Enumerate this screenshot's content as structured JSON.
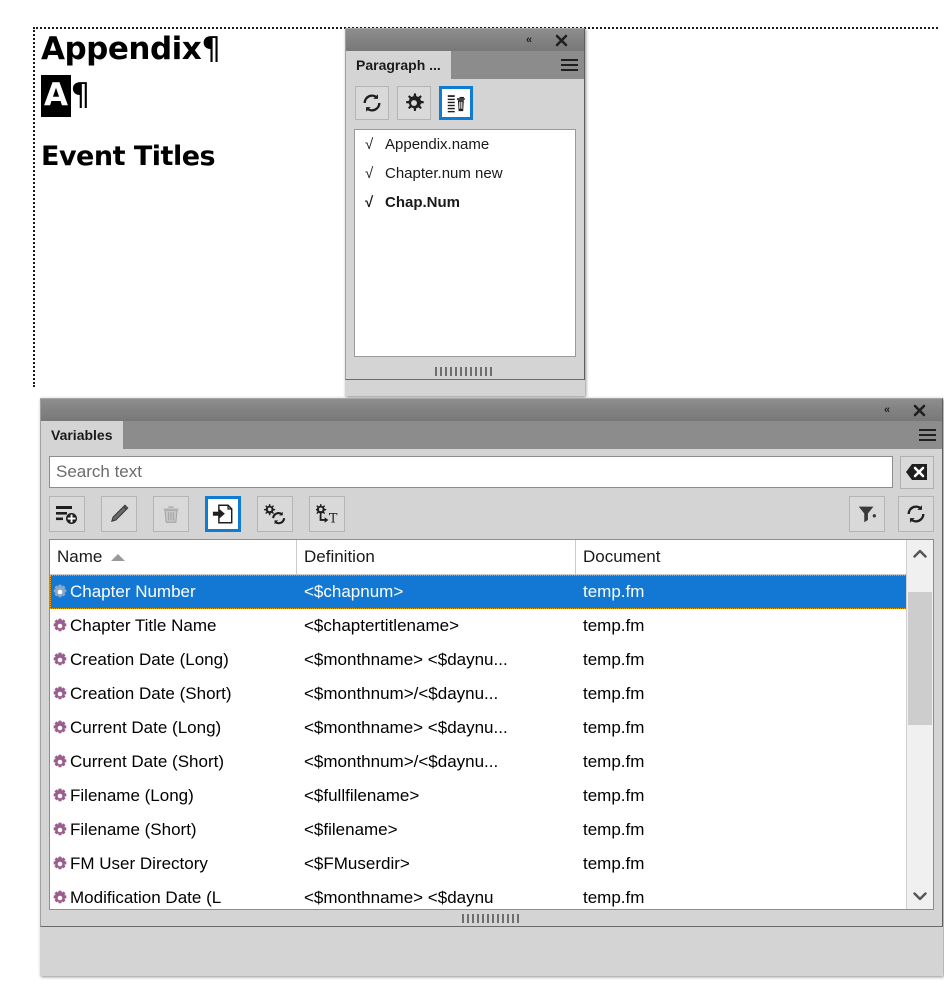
{
  "document": {
    "line1": "Appendix",
    "line1_pilcrow": "¶",
    "line2_selected": "A",
    "line2_pilcrow": "¶",
    "line3": "Event Titles"
  },
  "paragraph_panel": {
    "title_collapse": "«",
    "title_close": "✕",
    "tab_label": "Paragraph ...",
    "menu_icon": "hamburger-menu-icon",
    "toolbar": [
      {
        "name": "update-all-icon",
        "label": "Update All",
        "selected": false
      },
      {
        "name": "gear-settings-icon",
        "label": "Settings",
        "selected": false
      },
      {
        "name": "delete-format-icon",
        "label": "Delete Format",
        "selected": true
      }
    ],
    "items": [
      {
        "check": "√",
        "label": "Appendix.name",
        "bold": false
      },
      {
        "check": "√",
        "label": "Chapter.num new",
        "bold": false
      },
      {
        "check": "√",
        "label": "Chap.Num",
        "bold": true
      }
    ]
  },
  "variables_panel": {
    "title_collapse": "«",
    "title_close": "✕",
    "tab_label": "Variables",
    "menu_icon": "hamburger-menu-icon",
    "search": {
      "value": "",
      "placeholder": "Search text",
      "clear_icon": "clear-search-icon"
    },
    "toolbar": [
      {
        "name": "new-variable-icon",
        "label": "New Variable",
        "selected": false
      },
      {
        "name": "edit-variable-icon",
        "label": "Edit Variable",
        "selected": false
      },
      {
        "name": "delete-variable-icon",
        "label": "Delete Variable",
        "selected": false
      },
      {
        "name": "insert-variable-icon",
        "label": "Insert Variable",
        "selected": true
      },
      {
        "name": "convert-variable-icon",
        "label": "Convert Variable",
        "selected": false
      },
      {
        "name": "convert-to-text-icon",
        "label": "Convert to Text",
        "selected": false
      }
    ],
    "toolbar_right": [
      {
        "name": "filter-icon",
        "label": "Filter",
        "selected": false
      },
      {
        "name": "refresh-icon",
        "label": "Refresh",
        "selected": false
      }
    ],
    "table": {
      "columns": [
        "Name",
        "Definition",
        "Document"
      ],
      "sort_column": "Name",
      "sort_direction": "ascending",
      "rows": [
        {
          "name": "Chapter Number",
          "definition": "<$chapnum>",
          "document": "temp.fm",
          "selected": true
        },
        {
          "name": "Chapter Title Name",
          "definition": "<$chaptertitlename>",
          "document": "temp.fm",
          "selected": false
        },
        {
          "name": "Creation Date (Long)",
          "definition": "<$monthname> <$daynu...",
          "document": "temp.fm",
          "selected": false
        },
        {
          "name": "Creation Date (Short)",
          "definition": "<$monthnum>/<$daynu...",
          "document": "temp.fm",
          "selected": false
        },
        {
          "name": "Current Date (Long)",
          "definition": "<$monthname> <$daynu...",
          "document": "temp.fm",
          "selected": false
        },
        {
          "name": "Current Date (Short)",
          "definition": "<$monthnum>/<$daynu...",
          "document": "temp.fm",
          "selected": false
        },
        {
          "name": "Filename (Long)",
          "definition": "<$fullfilename>",
          "document": "temp.fm",
          "selected": false
        },
        {
          "name": "Filename (Short)",
          "definition": "<$filename>",
          "document": "temp.fm",
          "selected": false
        },
        {
          "name": "FM User Directory",
          "definition": "<$FMuserdir>",
          "document": "temp.fm",
          "selected": false
        },
        {
          "name": "Modification Date (L",
          "definition": "<$monthname> <$daynu",
          "document": "temp.fm",
          "selected": false
        }
      ]
    },
    "scrollbar": {
      "up_icon": "chevron-up-icon",
      "down_icon": "chevron-down-icon"
    }
  },
  "colors": {
    "selection_blue": "#1278d4",
    "accent_blue": "#0f7cd4",
    "focus_orange": "#f0a000",
    "panel_gray": "#d4d4d4",
    "titlebar_gray": "#828282",
    "variable_icon_purple": "#9b5d8e"
  }
}
